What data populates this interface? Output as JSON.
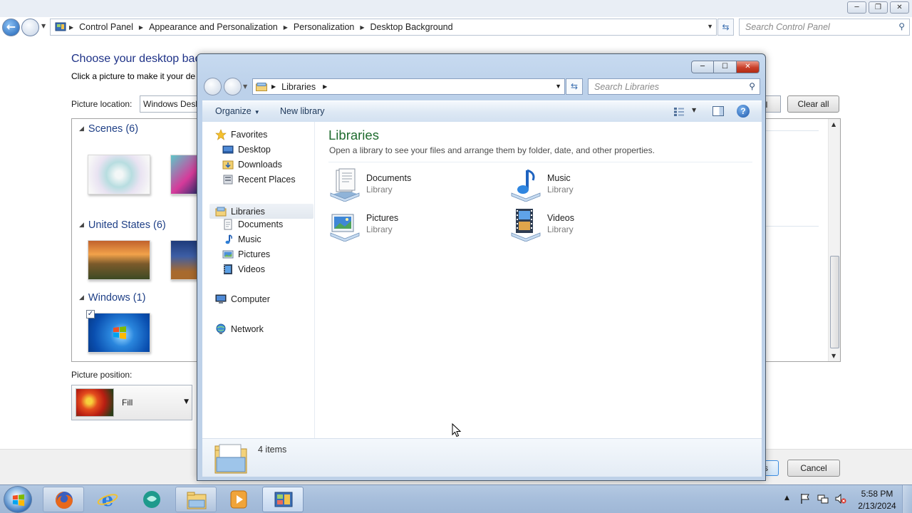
{
  "control_panel": {
    "breadcrumb": [
      "Control Panel",
      "Appearance and Personalization",
      "Personalization",
      "Desktop Background"
    ],
    "search_placeholder": "Search Control Panel",
    "heading": "Choose your desktop bac",
    "subheading": "Click a picture to make it your de",
    "picture_location_label": "Picture location:",
    "picture_location_value": "Windows Desk",
    "select_all_fragment": "ll",
    "clear_all_label": "Clear all",
    "groups": [
      {
        "title": "Scenes (6)"
      },
      {
        "title": "United States (6)"
      },
      {
        "title": "Windows (1)"
      }
    ],
    "picture_position_label": "Picture position:",
    "picture_position_value": "Fill",
    "save_fragment": "s",
    "cancel_label": "Cancel"
  },
  "explorer": {
    "address": [
      "Libraries"
    ],
    "search_placeholder": "Search Libraries",
    "toolbar": {
      "organize": "Organize",
      "new_library": "New library"
    },
    "nav": {
      "favorites": "Favorites",
      "favorites_items": [
        "Desktop",
        "Downloads",
        "Recent Places"
      ],
      "libraries": "Libraries",
      "libraries_items": [
        "Documents",
        "Music",
        "Pictures",
        "Videos"
      ],
      "computer": "Computer",
      "network": "Network"
    },
    "title": "Libraries",
    "description": "Open a library to see your files and arrange them by folder, date, and other properties.",
    "libraries": [
      {
        "name": "Documents",
        "type": "Library",
        "icon": "documents-library-icon"
      },
      {
        "name": "Music",
        "type": "Library",
        "icon": "music-library-icon"
      },
      {
        "name": "Pictures",
        "type": "Library",
        "icon": "pictures-library-icon"
      },
      {
        "name": "Videos",
        "type": "Library",
        "icon": "videos-library-icon"
      }
    ],
    "item_count": "4 items"
  },
  "taskbar": {
    "apps": [
      "firefox-icon",
      "internet-explorer-icon",
      "chat-icon",
      "windows-explorer-icon",
      "media-player-icon",
      "control-panel-icon"
    ],
    "time": "5:58 PM",
    "date": "2/13/2024"
  },
  "colors": {
    "explorer_title": "#1e6b2e",
    "cp_heading": "#1e3287",
    "taskbar": "#a8bfdc"
  }
}
